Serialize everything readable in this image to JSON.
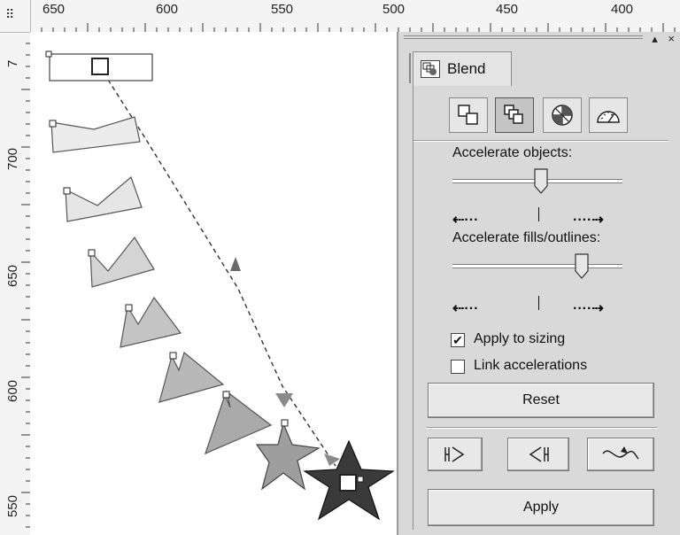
{
  "ruler": {
    "corner_symbol": "⠿",
    "top_labels": [
      "650",
      "600",
      "550",
      "500",
      "450",
      "400"
    ],
    "left_labels": [
      "700",
      "650",
      "600",
      "550"
    ],
    "left_partial": "7"
  },
  "docker": {
    "window_controls": "▴ ×",
    "tab_label": "Blend",
    "accelerate_objects_label": "Accelerate objects:",
    "accelerate_objects_value": 0.52,
    "accelerate_fills_label": "Accelerate fills/outlines:",
    "accelerate_fills_value": 0.76,
    "arrows_left": "⇠···",
    "arrows_right": "····⇢",
    "apply_sizing_label": "Apply to sizing",
    "apply_sizing_checked": true,
    "link_accel_label": "Link accelerations",
    "link_accel_checked": false,
    "reset_label": "Reset",
    "apply_label": "Apply",
    "check_mark": "✔"
  },
  "colors": {
    "panel_bg": "#d9d9d9",
    "shape_fill_light": "#ececec",
    "shape_fill_mid": "#b0b0b0",
    "shape_fill_dark": "#3a3a3a",
    "arrow_color": "#6a6a6a"
  }
}
